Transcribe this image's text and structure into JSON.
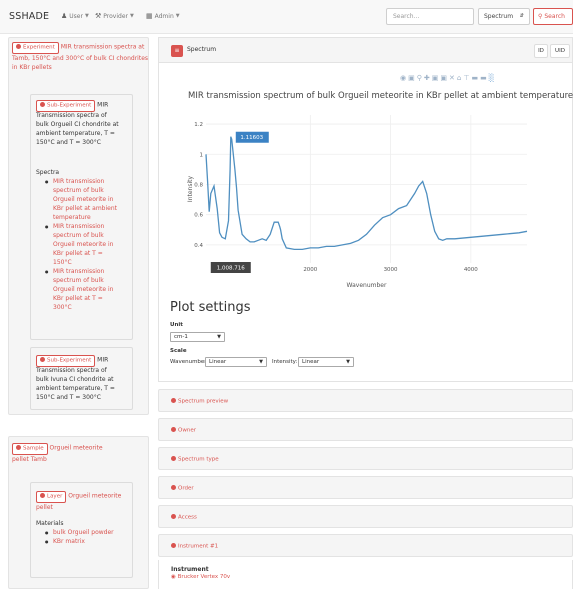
{
  "navbar": {
    "brand": "SSHADE",
    "user_label": "User",
    "provider_label": "Provider",
    "admin_label": "Admin",
    "search_placeholder": "Search...",
    "search_type": "Spectrum",
    "search_button": "Search"
  },
  "left": {
    "experiment_tag": "Experiment",
    "experiment_title": "MIR transmission spectra at Tamb, 150°C and 300°C of bulk CI chondrites in KBr pellets",
    "sub1_tag": "Sub-Experiment",
    "sub1_title_first": "MIR",
    "sub1_desc_lines": [
      "Transmission spectra of",
      "bulk Orgueil CI chondrite at",
      "ambient temperature, T =",
      "150°C and T = 300°C"
    ],
    "spectra_heading": "Spectra",
    "spectra_items": [
      [
        "MIR transmission",
        "spectrum of bulk",
        "Orgueil meteorite in",
        "KBr pellet at ambient",
        "temperature"
      ],
      [
        "MIR transmission",
        "spectrum of bulk",
        "Orgueil meteorite in",
        "KBr pellet at T =",
        "150°C"
      ],
      [
        "MIR transmission",
        "spectrum of bulk",
        "Orgueil meteorite in",
        "KBr pellet at T =",
        "300°C"
      ]
    ],
    "sub2_tag": "Sub-Experiment",
    "sub2_title_first": "MIR",
    "sub2_desc_lines": [
      "Transmission spectra of",
      "bulk Ivuna CI chondrite at",
      "ambient temperature, T =",
      "150°C and T = 300°C"
    ],
    "sample_tag": "Sample",
    "sample_title_lines": [
      "Orgueil meteorite",
      "pellet Tamb"
    ],
    "layer_tag": "Layer",
    "layer_title_lines": [
      "Orgueil meteorite",
      "pellet"
    ],
    "materials_heading": "Materials",
    "materials": [
      "bulk Orgueil powder",
      "KBr matrix"
    ]
  },
  "panel": {
    "title": "Spectrum",
    "id_button": "ID",
    "uid_button": "UID",
    "modebar_icons": [
      "camera-icon",
      "save-icon",
      "zoom-icon",
      "pan-icon",
      "zoom-in-icon",
      "zoom-out-icon",
      "autoscale-icon",
      "reset-icon",
      "spike-icon",
      "compare-icon",
      "hover-icon",
      "plotly-logo-icon"
    ]
  },
  "chart_data": {
    "type": "line",
    "title": "MIR transmission spectrum of bulk Orgueil meteorite in KBr pellet at ambient temperature",
    "xlabel": "Wavenumber",
    "ylabel": "Intensity",
    "xlim": [
      700,
      4700
    ],
    "ylim": [
      0.28,
      1.26
    ],
    "xticks": [
      2000,
      3000,
      4000
    ],
    "yticks": [
      0.4,
      0.6,
      0.8,
      1,
      1.2
    ],
    "ytick_labels": [
      "0.4",
      "0.6",
      "0.8",
      "1",
      "1.2"
    ],
    "grid": true,
    "line_color": "#4f8fc0",
    "x": [
      700,
      720,
      740,
      760,
      800,
      840,
      870,
      900,
      940,
      980,
      1000,
      1008.716,
      1020,
      1040,
      1060,
      1080,
      1100,
      1150,
      1200,
      1250,
      1300,
      1350,
      1400,
      1450,
      1500,
      1550,
      1600,
      1620,
      1630,
      1650,
      1700,
      1800,
      1900,
      2000,
      2100,
      2200,
      2300,
      2400,
      2500,
      2600,
      2700,
      2800,
      2900,
      3000,
      3100,
      3200,
      3300,
      3350,
      3400,
      3450,
      3500,
      3550,
      3600,
      3650,
      3700,
      3800,
      4000,
      4200,
      4400,
      4600,
      4700
    ],
    "y": [
      1.0,
      0.82,
      0.62,
      0.74,
      0.79,
      0.64,
      0.48,
      0.45,
      0.44,
      0.56,
      0.9,
      1.11603,
      1.1,
      1.0,
      0.9,
      0.78,
      0.63,
      0.47,
      0.44,
      0.42,
      0.42,
      0.43,
      0.44,
      0.43,
      0.47,
      0.55,
      0.55,
      0.52,
      0.5,
      0.44,
      0.38,
      0.37,
      0.37,
      0.38,
      0.38,
      0.39,
      0.39,
      0.4,
      0.41,
      0.43,
      0.47,
      0.53,
      0.58,
      0.6,
      0.64,
      0.66,
      0.74,
      0.79,
      0.82,
      0.74,
      0.6,
      0.49,
      0.44,
      0.43,
      0.44,
      0.44,
      0.45,
      0.46,
      0.47,
      0.48,
      0.49
    ],
    "hover_x_label": "1,008.716",
    "hover_y_label": "1.11603"
  },
  "plot_settings": {
    "heading": "Plot settings",
    "unit_label": "Unit",
    "unit_value": "cm-1",
    "scale_label": "Scale",
    "wavenumber_label": "Wavenumber:",
    "wavenumber_value": "Linear",
    "intensity_label": "Intensity:",
    "intensity_value": "Linear"
  },
  "sections": [
    "Spectrum preview",
    "Owner",
    "Spectrum type",
    "Order",
    "Access",
    "Instrument #1"
  ],
  "instrument": {
    "heading": "Instrument",
    "name": "Brucker Vertex 70v"
  }
}
